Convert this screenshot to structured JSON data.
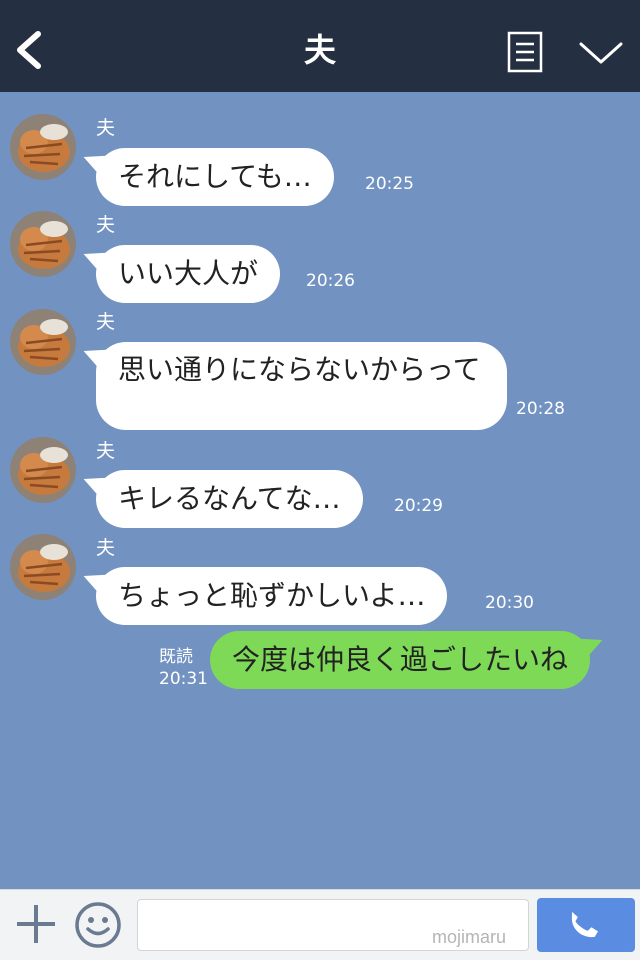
{
  "header": {
    "title": "夫"
  },
  "messages": [
    {
      "sender": "夫",
      "text": "それにしても…",
      "time": "20:25"
    },
    {
      "sender": "夫",
      "text": "いい大人が",
      "time": "20:26"
    },
    {
      "sender": "夫",
      "text": "思い通りにならないからって",
      "time": "20:28"
    },
    {
      "sender": "夫",
      "text": "キレるなんてな…",
      "time": "20:29"
    },
    {
      "sender": "夫",
      "text": "ちょっと恥ずかしいよ…",
      "time": "20:30"
    }
  ],
  "my_message": {
    "text": "今度は仲良く過ごしたいね",
    "read_label": "既読",
    "time": "20:31"
  },
  "footer": {
    "input_value": "",
    "watermark": "mojimaru"
  },
  "colors": {
    "header_bg": "#243041",
    "chat_bg": "#7292c2",
    "my_bubble": "#7ed957",
    "call_button": "#5a8de2"
  }
}
